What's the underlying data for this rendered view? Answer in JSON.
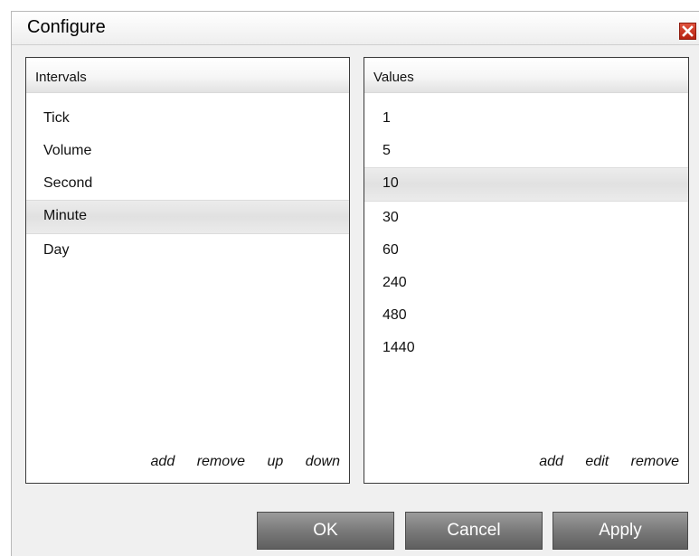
{
  "dialog": {
    "title": "Configure",
    "close_icon": "close-icon"
  },
  "intervals": {
    "header": "Intervals",
    "items": [
      "Tick",
      "Volume",
      "Second",
      "Minute",
      "Day"
    ],
    "selected": "Minute",
    "actions": {
      "add": "add",
      "remove": "remove",
      "up": "up",
      "down": "down"
    }
  },
  "values": {
    "header": "Values",
    "items": [
      "1",
      "5",
      "10",
      "30",
      "60",
      "240",
      "480",
      "1440"
    ],
    "selected": "10",
    "actions": {
      "add": "add",
      "edit": "edit",
      "remove": "remove"
    }
  },
  "buttons": {
    "ok": "OK",
    "cancel": "Cancel",
    "apply": "Apply"
  },
  "colors": {
    "close_button": "#c8301c",
    "button_bg": "#7a7a7a",
    "selection_bg": "#e6e6e6"
  }
}
